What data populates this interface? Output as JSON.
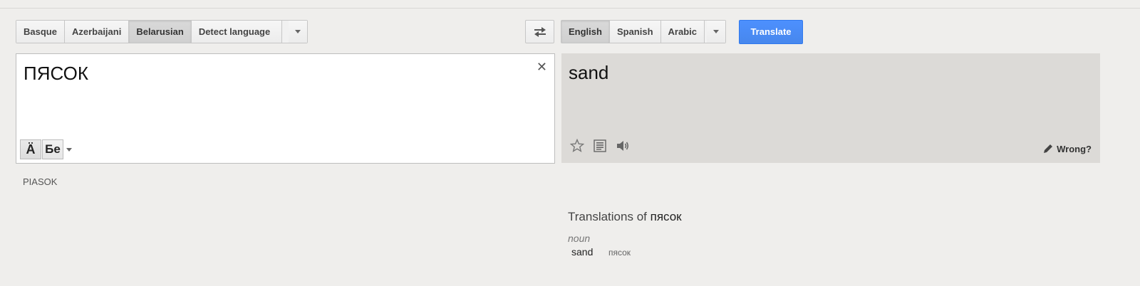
{
  "source_langs": {
    "items": [
      "Basque",
      "Azerbaijani",
      "Belarusian",
      "Detect language"
    ],
    "active": "Belarusian"
  },
  "target_langs": {
    "items": [
      "English",
      "Spanish",
      "Arabic"
    ],
    "active": "English"
  },
  "translate_label": "Translate",
  "source": {
    "text": "ПЯСОК",
    "ime_key_1": "Ä",
    "ime_key_2": "Бе"
  },
  "target": {
    "text": "sand",
    "wrong_label": "Wrong?"
  },
  "transliteration": "PIASOK",
  "dictionary": {
    "title_prefix": "Translations of",
    "word": "пясок",
    "pos": "noun",
    "entries": [
      {
        "term": "sand",
        "reverse": "пясок"
      }
    ]
  },
  "icons": {
    "swap": "swap-arrows-icon",
    "clear": "close-icon",
    "star": "star-icon",
    "list": "list-icon",
    "speaker": "speaker-icon",
    "pencil": "pencil-icon"
  },
  "colors": {
    "translate_button": "#4d90fe",
    "page_bg": "#efeeec",
    "target_bg": "#dcdad7"
  }
}
